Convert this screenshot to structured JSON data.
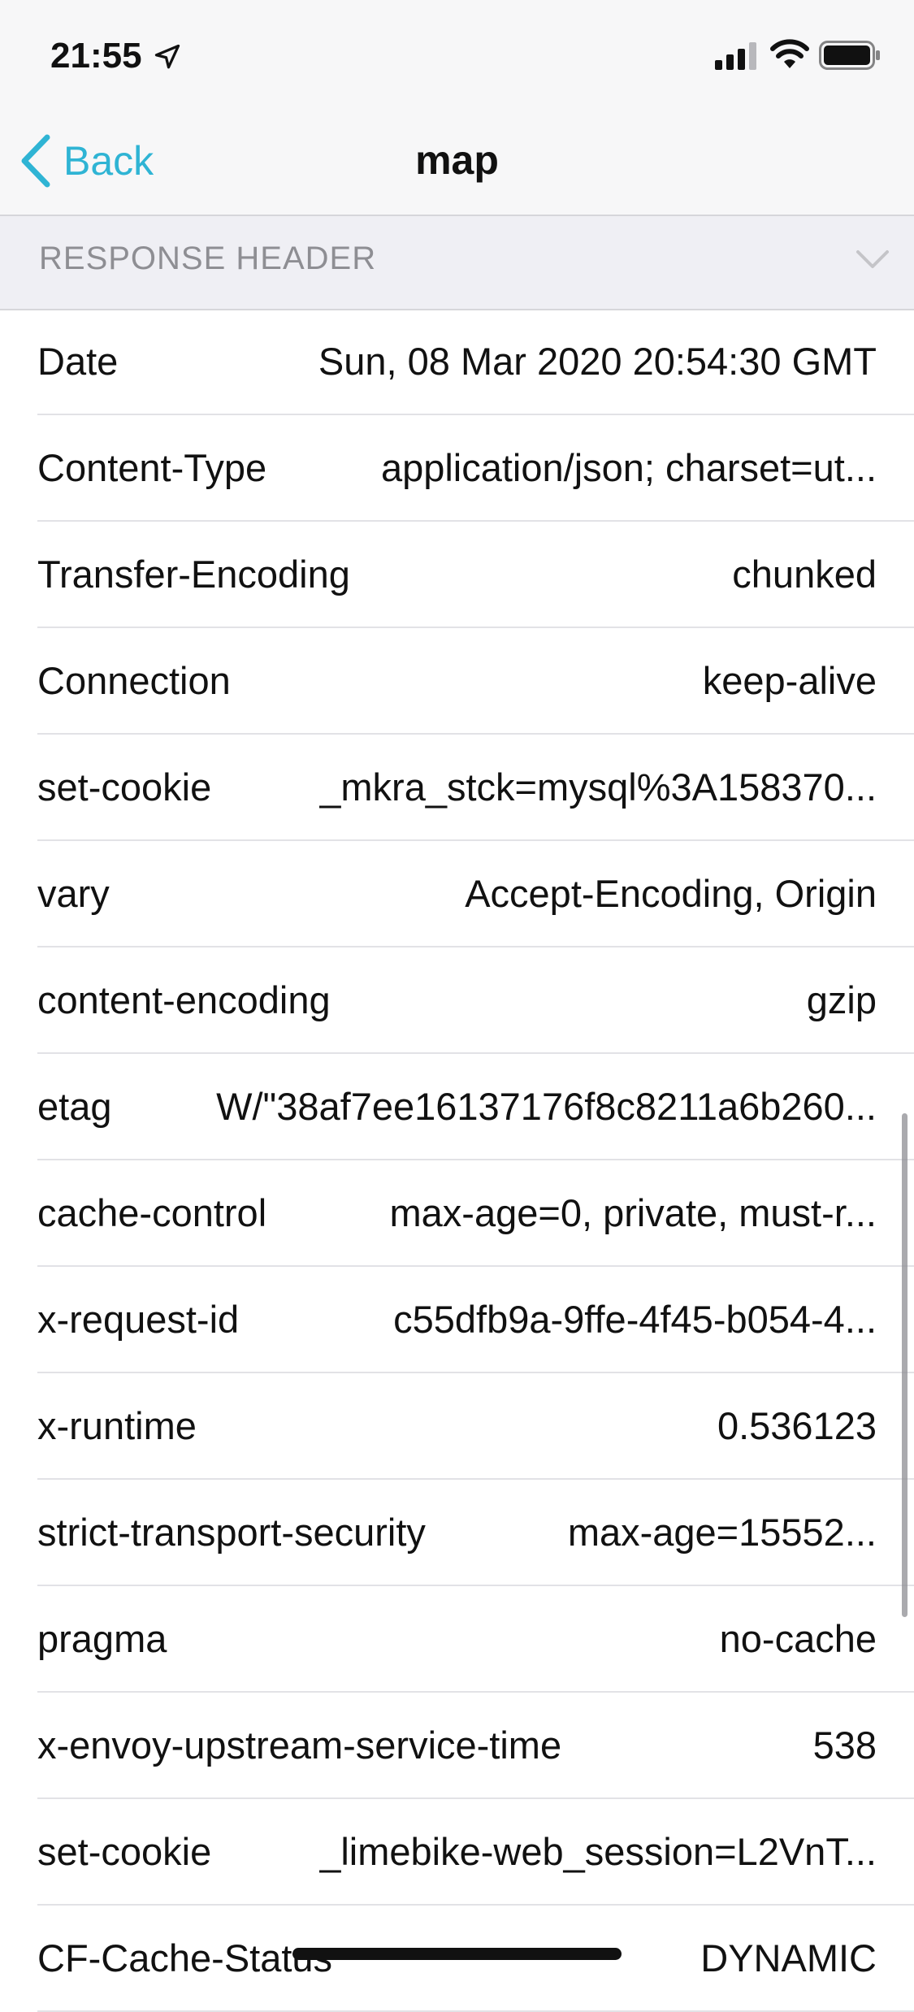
{
  "status_bar": {
    "time": "21:55"
  },
  "nav": {
    "back_label": "Back",
    "title": "map"
  },
  "section": {
    "title": "RESPONSE HEADER"
  },
  "headers": [
    {
      "key": "Date",
      "value": "Sun, 08 Mar 2020 20:54:30 GMT"
    },
    {
      "key": "Content-Type",
      "value": "application/json; charset=ut..."
    },
    {
      "key": "Transfer-Encoding",
      "value": "chunked"
    },
    {
      "key": "Connection",
      "value": "keep-alive"
    },
    {
      "key": "set-cookie",
      "value": "_mkra_stck=mysql%3A158370..."
    },
    {
      "key": "vary",
      "value": "Accept-Encoding, Origin"
    },
    {
      "key": "content-encoding",
      "value": "gzip"
    },
    {
      "key": "etag",
      "value": "W/\"38af7ee16137176f8c8211a6b260..."
    },
    {
      "key": "cache-control",
      "value": "max-age=0, private, must-r..."
    },
    {
      "key": "x-request-id",
      "value": "c55dfb9a-9ffe-4f45-b054-4..."
    },
    {
      "key": "x-runtime",
      "value": "0.536123"
    },
    {
      "key": "strict-transport-security",
      "value": "max-age=15552..."
    },
    {
      "key": "pragma",
      "value": "no-cache"
    },
    {
      "key": "x-envoy-upstream-service-time",
      "value": "538"
    },
    {
      "key": "set-cookie",
      "value": "_limebike-web_session=L2VnT..."
    },
    {
      "key": "CF-Cache-Status",
      "value": "DYNAMIC"
    }
  ],
  "colors": {
    "accent": "#2fb4d4",
    "secondary_text": "#8e8e93",
    "section_background": "#efeff4"
  },
  "icons": {
    "location": "location-arrow-icon",
    "signal": "cellular-signal-icon",
    "wifi": "wifi-icon",
    "battery": "battery-icon",
    "back": "chevron-left-icon",
    "section_toggle": "chevron-down-icon"
  }
}
